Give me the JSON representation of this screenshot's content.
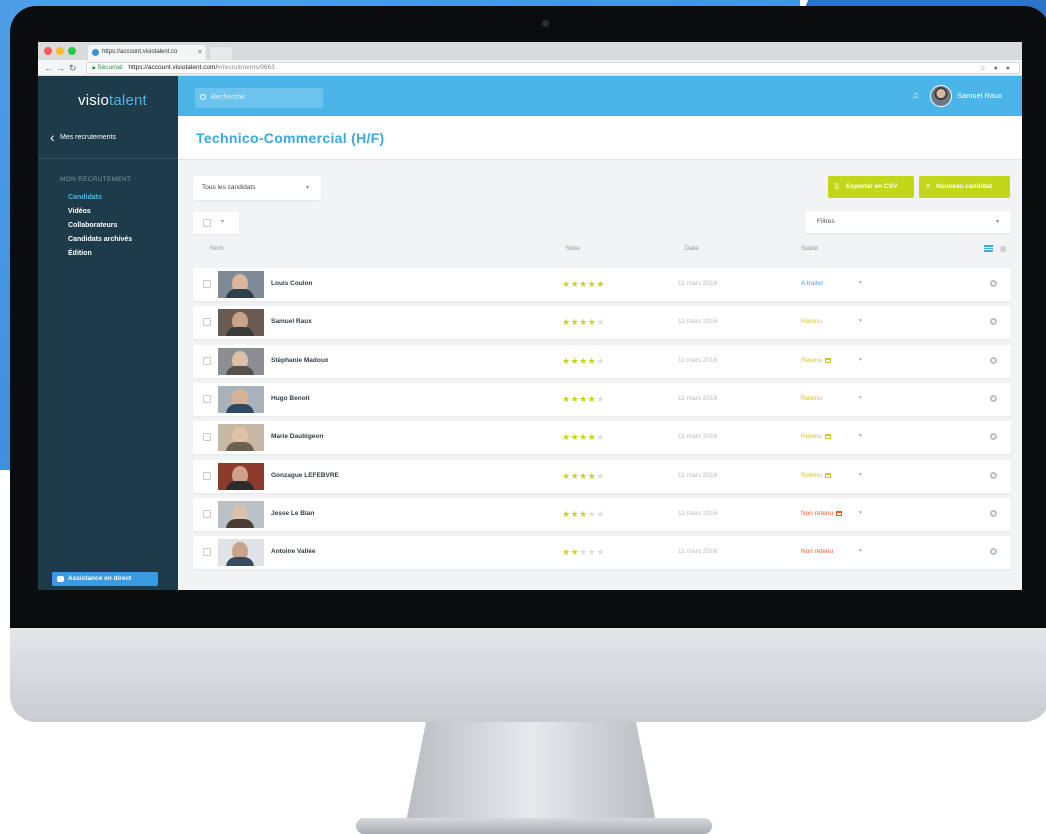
{
  "browser": {
    "tab_title": "https://account.visiotalent.co",
    "tab_close": "×",
    "secure_label": "Sécurisé",
    "url_host": "https://account.visiotalent.com/",
    "url_path": "#/recruitments/9663"
  },
  "sidebar": {
    "logo_main": "visio",
    "logo_accent": "talent",
    "back_label": "Mes recrutements",
    "section_title": "MON RECRUTEMENT",
    "items": [
      {
        "label": "Candidats",
        "active": true
      },
      {
        "label": "Vidéos",
        "active": false
      },
      {
        "label": "Collaborateurs",
        "active": false
      },
      {
        "label": "Candidats archivés",
        "active": false
      },
      {
        "label": "Édition",
        "active": false
      }
    ],
    "assist_label": "Assistance en direct"
  },
  "topbar": {
    "search_placeholder": "Recherche",
    "user_name": "Samuel Raux"
  },
  "page": {
    "title": "Technico-Commercial (H/F)"
  },
  "controls": {
    "candidates_select": "Tous les candidats",
    "export_label": "Exporter en CSV",
    "new_candidate_label": "Nouveau candidat",
    "filters_label": "Filtres"
  },
  "table": {
    "headers": {
      "name": "Nom",
      "rating": "Note",
      "date": "Date",
      "status": "Statut"
    },
    "rows": [
      {
        "name": "Louis Coulon",
        "rating": 5,
        "date": "11 mars 2016",
        "status": "A traiter",
        "status_color": "blue",
        "calendar": false
      },
      {
        "name": "Samuel Raux",
        "rating": 4,
        "date": "11 mars 2016",
        "status": "Retenu",
        "status_color": "yellow",
        "calendar": false
      },
      {
        "name": "Stéphanie Madoux",
        "rating": 4,
        "date": "11 mars 2016",
        "status": "Retenu",
        "status_color": "yellow",
        "calendar": true
      },
      {
        "name": "Hugo Benoit",
        "rating": 4,
        "date": "11 mars 2016",
        "status": "Retenu",
        "status_color": "yellow",
        "calendar": false
      },
      {
        "name": "Marie Daubigeon",
        "rating": 4,
        "date": "11 mars 2016",
        "status": "Retenu",
        "status_color": "yellow",
        "calendar": true
      },
      {
        "name": "Gonzague LEFEBVRE",
        "rating": 4,
        "date": "11 mars 2016",
        "status": "Retenu",
        "status_color": "yellow",
        "calendar": true
      },
      {
        "name": "Jesse Le Blan",
        "rating": 3,
        "date": "11 mars 2016",
        "status": "Non retenu",
        "status_color": "red",
        "calendar": true
      },
      {
        "name": "Antoine Vallée",
        "rating": 2,
        "date": "11 mars 2016",
        "status": "Non retenu",
        "status_color": "red",
        "calendar": false
      }
    ]
  },
  "colors": {
    "accent_blue": "#4ab5e8",
    "sidebar": "#1e3b49",
    "green_button": "#c2d61a",
    "star": "#c2d61a",
    "status_red": "#ef5b2b"
  }
}
